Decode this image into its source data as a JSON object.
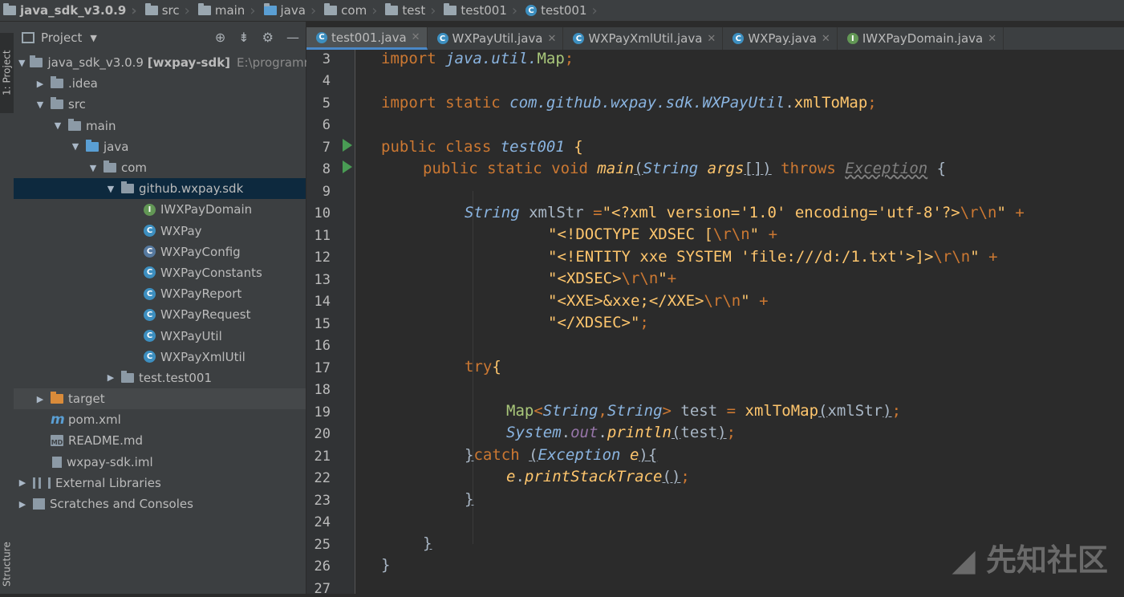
{
  "breadcrumb": [
    "java_sdk_v3.0.9",
    "src",
    "main",
    "java",
    "com",
    "test",
    "test001",
    "test001"
  ],
  "strip": {
    "project": "1: Project",
    "structure": "Structure"
  },
  "project_panel": {
    "title": "Project"
  },
  "tree": [
    {
      "label": "java_sdk_v3.0.9",
      "extra": "[wxpay-sdk]",
      "path": "E:\\programme"
    },
    {
      "label": ".idea"
    },
    {
      "label": "src"
    },
    {
      "label": "main"
    },
    {
      "label": "java"
    },
    {
      "label": "com"
    },
    {
      "label": "github.wxpay.sdk"
    },
    {
      "label": "IWXPayDomain"
    },
    {
      "label": "WXPay"
    },
    {
      "label": "WXPayConfig"
    },
    {
      "label": "WXPayConstants"
    },
    {
      "label": "WXPayReport"
    },
    {
      "label": "WXPayRequest"
    },
    {
      "label": "WXPayUtil"
    },
    {
      "label": "WXPayXmlUtil"
    },
    {
      "label": "test.test001"
    },
    {
      "label": "target"
    },
    {
      "label": "pom.xml"
    },
    {
      "label": "README.md"
    },
    {
      "label": "wxpay-sdk.iml"
    },
    {
      "label": "External Libraries"
    },
    {
      "label": "Scratches and Consoles"
    }
  ],
  "tabs": [
    "test001.java",
    "WXPayUtil.java",
    "WXPayXmlUtil.java",
    "WXPay.java",
    "IWXPayDomain.java"
  ],
  "line_numbers": [
    "3",
    "4",
    "5",
    "6",
    "7",
    "8",
    "9",
    "10",
    "11",
    "12",
    "13",
    "14",
    "15",
    "16",
    "17",
    "18",
    "19",
    "20",
    "21",
    "22",
    "23",
    "24",
    "25",
    "26",
    "27"
  ],
  "watermark": "先知社区"
}
